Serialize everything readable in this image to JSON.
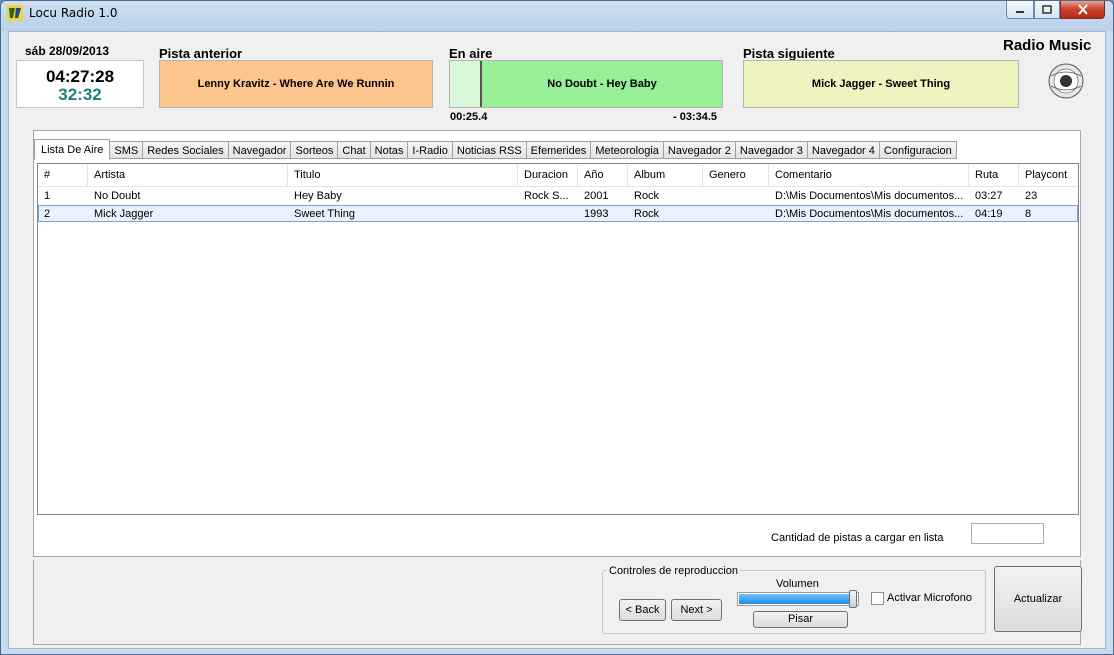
{
  "window": {
    "title": "Locu Radio 1.0"
  },
  "header": {
    "date": "sáb 28/09/2013",
    "clock": "04:27:28",
    "clock_sub": "32:32",
    "prev_label": "Pista anterior",
    "prev_track": "Lenny Kravitz - Where Are We Runnin",
    "onair_label": "En aire",
    "onair_track": "No Doubt - Hey Baby",
    "onair_elapsed": "00:25.4",
    "onair_remaining": "- 03:34.5",
    "next_label": "Pista siguiente",
    "next_track": "Mick Jagger - Sweet Thing",
    "brand": "Radio Music"
  },
  "tabs": [
    "Lista De Aire",
    "SMS",
    "Redes Sociales",
    "Navegador",
    "Sorteos",
    "Chat",
    "Notas",
    "I-Radio",
    "Noticias RSS",
    "Efemerides",
    "Meteorologia",
    "Navegador 2",
    "Navegador 3",
    "Navegador 4",
    "Configuracion"
  ],
  "playlist": {
    "columns": [
      "#",
      "Artista",
      "Titulo",
      "Duracion",
      "Año",
      "Album",
      "Genero",
      "Comentario",
      "Ruta",
      "Playcont"
    ],
    "rows": [
      [
        "1",
        "No Doubt",
        "Hey Baby",
        "Rock S...",
        "2001",
        "Rock",
        "",
        "D:\\Mis Documentos\\Mis documentos...",
        "03:27",
        "23"
      ],
      [
        "2",
        "Mick Jagger",
        "Sweet Thing",
        "",
        "1993",
        "Rock",
        "",
        "D:\\Mis Documentos\\Mis documentos...",
        "04:19",
        "8"
      ]
    ],
    "selected_row": 1
  },
  "qty": {
    "label": "Cantidad de pistas a cargar en lista",
    "value": ""
  },
  "controls": {
    "legend": "Controles de reproduccion",
    "back": "< Back",
    "next": "Next >",
    "volume_label": "Volumen",
    "volume_level": 0.95,
    "pisar": "Pisar",
    "mic_label": "Activar Microfono",
    "mic_checked": false,
    "refresh": "Actualizar"
  },
  "colors": {
    "prev": "#fbc58d",
    "onair": "#97f097",
    "next": "#eef3c0",
    "clock_sub": "#1f7f7f"
  }
}
